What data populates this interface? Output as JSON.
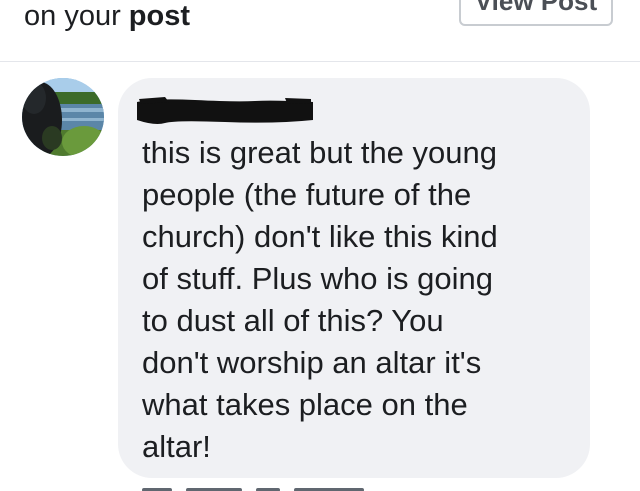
{
  "notification": {
    "prefix": "on your",
    "bold_word": "post"
  },
  "header": {
    "view_post_label": "View Post"
  },
  "comment": {
    "avatar_icon": "profile-photo-river-icon",
    "author_redacted": true,
    "lines": [
      "this is great but the young",
      "people (the future of the",
      "church) don't like this kind",
      "of stuff. Plus who is going",
      "to dust all of this?  You",
      "don't worship an altar it's",
      "what takes place on the",
      "altar!"
    ]
  },
  "colors": {
    "bubble_bg": "#f0f1f4",
    "text": "#1c1e21",
    "button_border": "#c8ccd1",
    "button_text": "#4b4f56"
  }
}
